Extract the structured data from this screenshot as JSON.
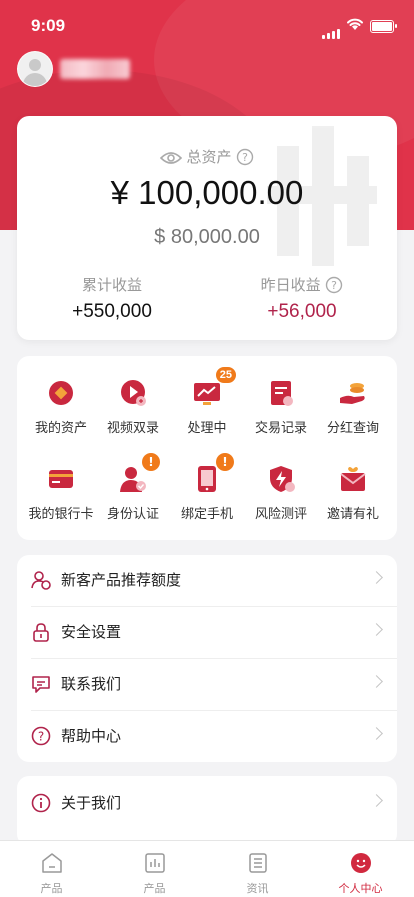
{
  "status_bar": {
    "time": "9:09"
  },
  "user": {
    "avatar": "avatar-icon"
  },
  "assets": {
    "title": "总资产",
    "total": "¥ 100,000.00",
    "usd": "$ 80,000.00",
    "cumulative_label": "累计收益",
    "cumulative_value": "+550,000",
    "yesterday_label": "昨日收益",
    "yesterday_value": "+56,000"
  },
  "grid": [
    {
      "label": "我的资产",
      "icon": "coin-icon"
    },
    {
      "label": "视频双录",
      "icon": "video-play-icon"
    },
    {
      "label": "处理中",
      "icon": "chart-monitor-icon",
      "badge": "25"
    },
    {
      "label": "交易记录",
      "icon": "document-icon"
    },
    {
      "label": "分红查询",
      "icon": "hand-coins-icon"
    },
    {
      "label": "我的银行卡",
      "icon": "bank-card-icon"
    },
    {
      "label": "身份认证",
      "icon": "id-person-icon",
      "badge": "!"
    },
    {
      "label": "绑定手机",
      "icon": "phone-icon",
      "badge": "!"
    },
    {
      "label": "风险测评",
      "icon": "shield-bolt-icon"
    },
    {
      "label": "邀请有礼",
      "icon": "gift-envelope-icon"
    }
  ],
  "menu1": [
    {
      "label": "新客产品推荐额度",
      "icon": "user-coin-icon"
    },
    {
      "label": "安全设置",
      "icon": "lock-icon"
    },
    {
      "label": "联系我们",
      "icon": "message-icon"
    },
    {
      "label": "帮助中心",
      "icon": "help-icon"
    }
  ],
  "menu2": [
    {
      "label": "关于我们",
      "icon": "info-icon"
    }
  ],
  "tabs": [
    {
      "label": "产品",
      "icon": "home-icon"
    },
    {
      "label": "产品",
      "icon": "bar-chart-icon"
    },
    {
      "label": "资讯",
      "icon": "news-icon"
    },
    {
      "label": "个人中心",
      "icon": "profile-icon",
      "active": true
    }
  ],
  "colors": {
    "brand": "#e0334a",
    "accent_dark": "#b71c3a",
    "badge": "#f07a1a",
    "profit": "#b0234b"
  }
}
